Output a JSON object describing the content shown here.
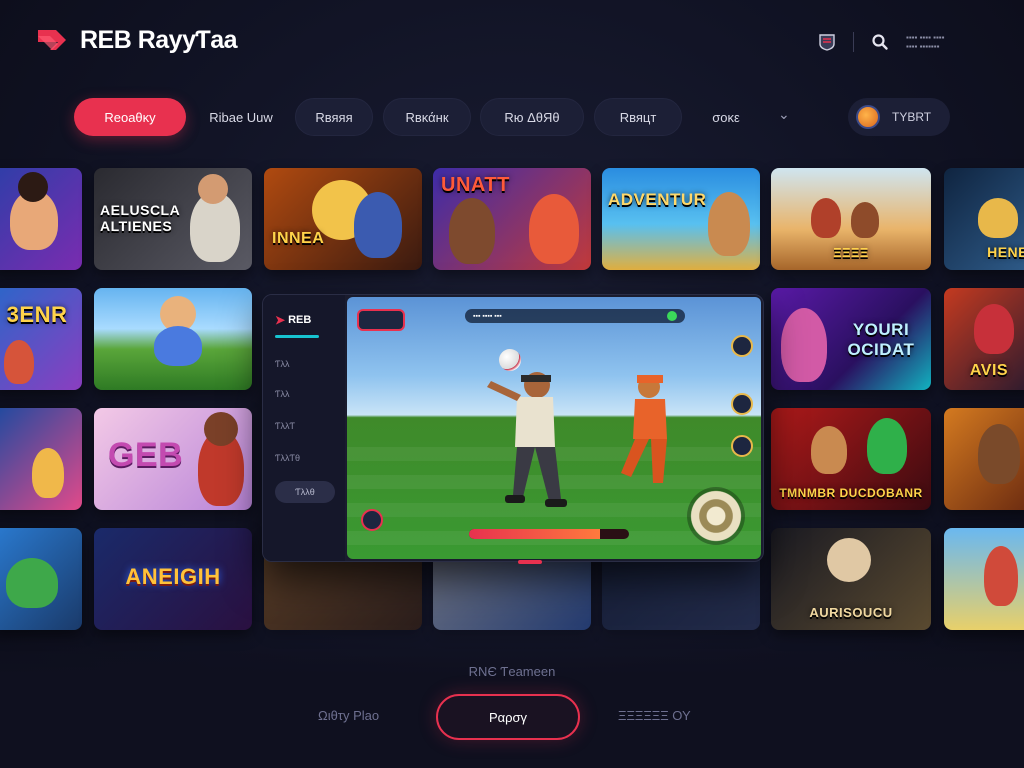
{
  "app": {
    "title": "REB RayyƬaa"
  },
  "header": {
    "meta_lines": [
      "▪▪▪▪ ▪▪▪▪ ▪▪▪▪",
      "▪▪▪▪ ▪▪▪▪▪▪▪"
    ],
    "icons": [
      "shield-icon",
      "search-icon"
    ]
  },
  "nav": {
    "tabs": [
      {
        "label": "Reoaθκy"
      },
      {
        "label": "Ribae Uuw"
      },
      {
        "label": "Rвяяя"
      },
      {
        "label": "Rвκάнк"
      },
      {
        "label": "Rю ΔθЯθ"
      },
      {
        "label": "Rвяцт"
      },
      {
        "label": "σoκε"
      }
    ],
    "profile_label": "TYBRT"
  },
  "cards": [
    {
      "title": ""
    },
    {
      "title": "AELUSCLA ALTIENES"
    },
    {
      "title": "INNEA"
    },
    {
      "title": "UNATT"
    },
    {
      "title": "ADVENTUR"
    },
    {
      "title": "ΞΞΞΞ"
    },
    {
      "title": "HENE"
    },
    {
      "title": "3ENR"
    },
    {
      "title": ""
    },
    {
      "title": "YOURI OCIDAT"
    },
    {
      "title": "AVIS"
    },
    {
      "title": ""
    },
    {
      "title": "GEB"
    },
    {
      "title": "TMNMBR DUCDOBANR"
    },
    {
      "title": ""
    },
    {
      "title": ""
    },
    {
      "title": "ANEIGIH"
    },
    {
      "title": "AURISOUCU"
    },
    {
      "title": ""
    }
  ],
  "modal": {
    "brand": "REB",
    "side_items": [
      "Ƭλλ",
      "Ƭλλ",
      "ƬλλƬ",
      "ƬλλƬθ"
    ],
    "side_button": "Ƭλλθ",
    "hud_score": "▪▪▪  ▪▪▪▪  ▪▪▪",
    "hud_progress": 0.82
  },
  "footer": {
    "label": "RNЄ Ƭeameen",
    "left_link": "Ωιθτy Ρlao",
    "play_button": "Ραρσγ",
    "right_link": "ΞΞΞΞΞΞ ΟΥ"
  }
}
